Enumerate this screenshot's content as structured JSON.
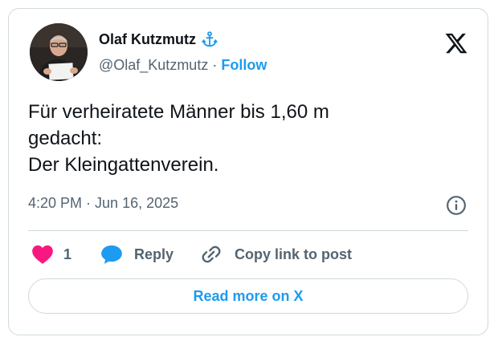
{
  "author": {
    "name": "Olaf Kutzmutz",
    "badge_icon": "anchor-icon",
    "handle": "@Olaf_Kutzmutz",
    "separator": "·",
    "follow_label": "Follow"
  },
  "brand_icon": "x-logo-icon",
  "tweet": {
    "lines": [
      "Für verheiratete Männer bis 1,60 m",
      "gedacht:",
      "Der Kleingattenverein."
    ],
    "time": "4:20 PM",
    "separator": "·",
    "date": "Jun 16, 2025"
  },
  "actions": {
    "like_count": "1",
    "reply_label": "Reply",
    "copy_label": "Copy link to post"
  },
  "read_more_label": "Read more on X",
  "colors": {
    "accent": "#1d9bf0",
    "heart": "#f91880",
    "text": "#0f1419",
    "muted": "#536471",
    "border": "#cfd9de"
  }
}
